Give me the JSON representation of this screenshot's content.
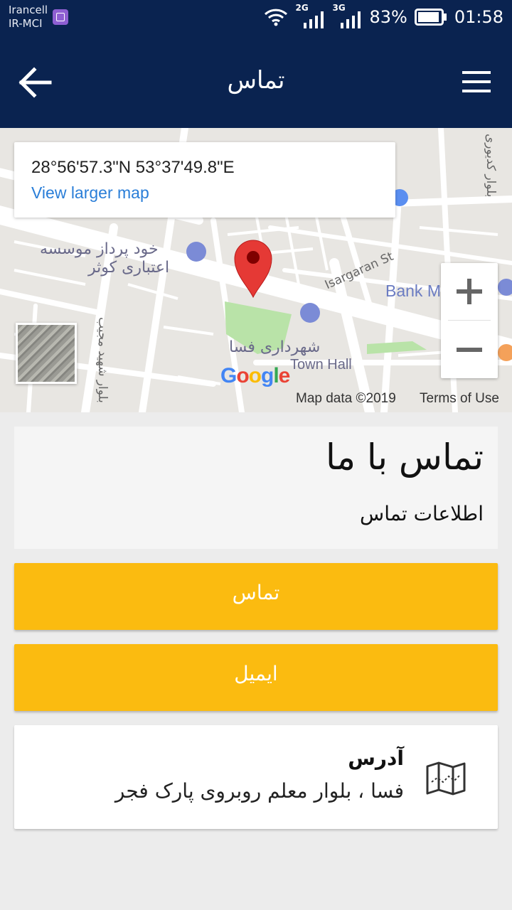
{
  "status_bar": {
    "carrier_1": "Irancell",
    "carrier_2": "IR-MCI",
    "network_1": "2G",
    "network_2": "3G",
    "battery": "83%",
    "time": "01:58"
  },
  "app_bar": {
    "title": "تماس",
    "back_icon": "arrow-left-icon",
    "menu_icon": "hamburger-menu-icon"
  },
  "map": {
    "coordinates": "28°56'57.3\"N 53°37'49.8\"E",
    "view_larger_map": "View larger map",
    "labels": {
      "poi_1_line_1": "خود پرداز موسسه",
      "poi_1_line_2": "اعتباری کوثر",
      "street_1": "Isargaran St",
      "bank": "Bank M",
      "town_hall_fa": "شهرداری فسا",
      "town_hall_en": "Town Hall",
      "street_2": "بلوار کدیوری",
      "street_3": "بلوار شهید مجیب"
    },
    "google": [
      "G",
      "o",
      "o",
      "g",
      "l",
      "e"
    ],
    "google_colors": [
      "#4285F4",
      "#EA4335",
      "#FBBC05",
      "#4285F4",
      "#34A853",
      "#EA4335"
    ],
    "map_data": "Map data ©2019",
    "terms_of_use": "Terms of Use",
    "pin_color": "#e53935"
  },
  "contact": {
    "title": "تماس با ما",
    "subtitle": "اطلاعات تماس",
    "call_button": "تماس",
    "email_button": "ایمیل",
    "address_title": "آدرس",
    "address_text": "فسا ، بلوار معلم روبروی پارک فجر",
    "address_icon": "folded-map-icon"
  },
  "colors": {
    "primary": "#0a2350",
    "accent": "#fbbb10",
    "link": "#2a7ed8"
  }
}
